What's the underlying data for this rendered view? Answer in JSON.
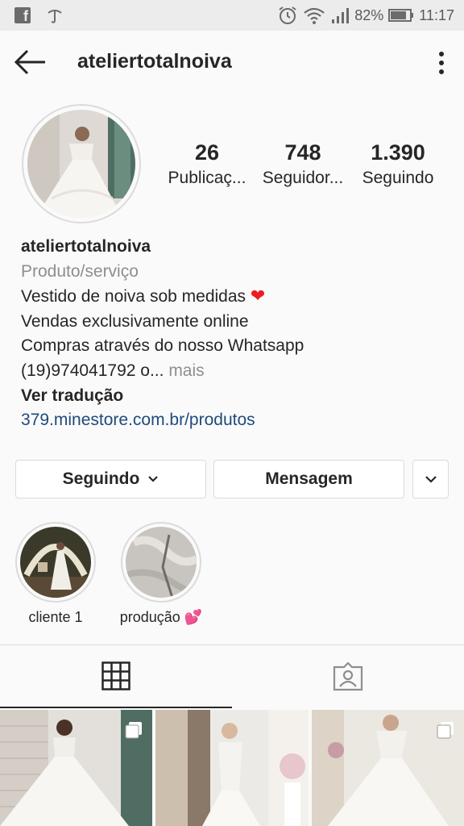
{
  "status_bar": {
    "facebook_glyph": "f",
    "battery_percent": "82%",
    "time": "11:17",
    "icons": [
      "facebook-icon",
      "notification-icon",
      "alarm-icon",
      "wifi-icon",
      "signal-icon",
      "battery-icon"
    ]
  },
  "header": {
    "username": "ateliertotalnoiva",
    "icons": [
      "back-arrow-icon",
      "more-vertical-icon"
    ]
  },
  "stats": [
    {
      "value": "26",
      "label": "Publicaç..."
    },
    {
      "value": "748",
      "label": "Seguidor..."
    },
    {
      "value": "1.390",
      "label": "Seguindo"
    }
  ],
  "bio": {
    "name": "ateliertotalnoiva",
    "category": "Produto/serviço",
    "line1": "Vestido de noiva sob medidas",
    "line1_emoji": "❤",
    "line2": "Vendas exclusivamente online",
    "line3": "Compras através do nosso Whatsapp",
    "line4": "(19)974041792 o...",
    "more_label": " mais",
    "translate_label": "Ver tradução",
    "link": "379.minestore.com.br/produtos"
  },
  "actions": {
    "following_label": "Seguindo",
    "message_label": "Mensagem"
  },
  "highlights": [
    {
      "label": "cliente 1"
    },
    {
      "label": "produção",
      "emoji": "💕"
    }
  ],
  "tabs": [
    "grid-icon",
    "tagged-icon"
  ],
  "colors": {
    "text": "#262626",
    "muted": "#8e8e8e",
    "link": "#1f4a7c",
    "border": "#dbdbdb",
    "heart": "#ed1c24"
  }
}
